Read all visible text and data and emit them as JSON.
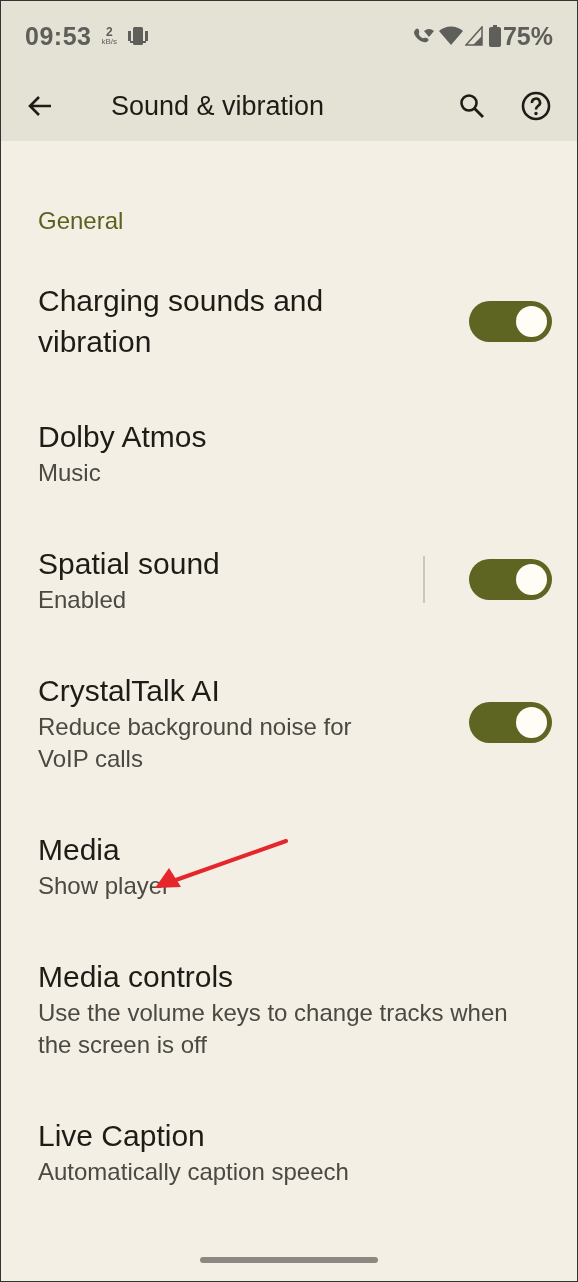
{
  "status_bar": {
    "time": "09:53",
    "speed_value": "2",
    "speed_unit": "kB/s",
    "battery": "75%"
  },
  "app_bar": {
    "title": "Sound & vibration"
  },
  "section": {
    "title": "General"
  },
  "items": [
    {
      "kind": "toggle",
      "title": "Charging sounds and vibration",
      "on": true
    },
    {
      "kind": "plain",
      "title": "Dolby Atmos",
      "summary": "Music"
    },
    {
      "kind": "split_toggle",
      "title": "Spatial sound",
      "summary": "Enabled",
      "on": true
    },
    {
      "kind": "toggle",
      "title": "CrystalTalk AI",
      "summary": "Reduce background noise for VoIP calls",
      "on": true
    },
    {
      "kind": "plain",
      "title": "Media",
      "summary": "Show player",
      "annotated": true
    },
    {
      "kind": "plain",
      "title": "Media controls",
      "summary": "Use the volume keys to change tracks when the screen is off"
    },
    {
      "kind": "plain",
      "title": "Live Caption",
      "summary": "Automatically caption speech"
    }
  ]
}
